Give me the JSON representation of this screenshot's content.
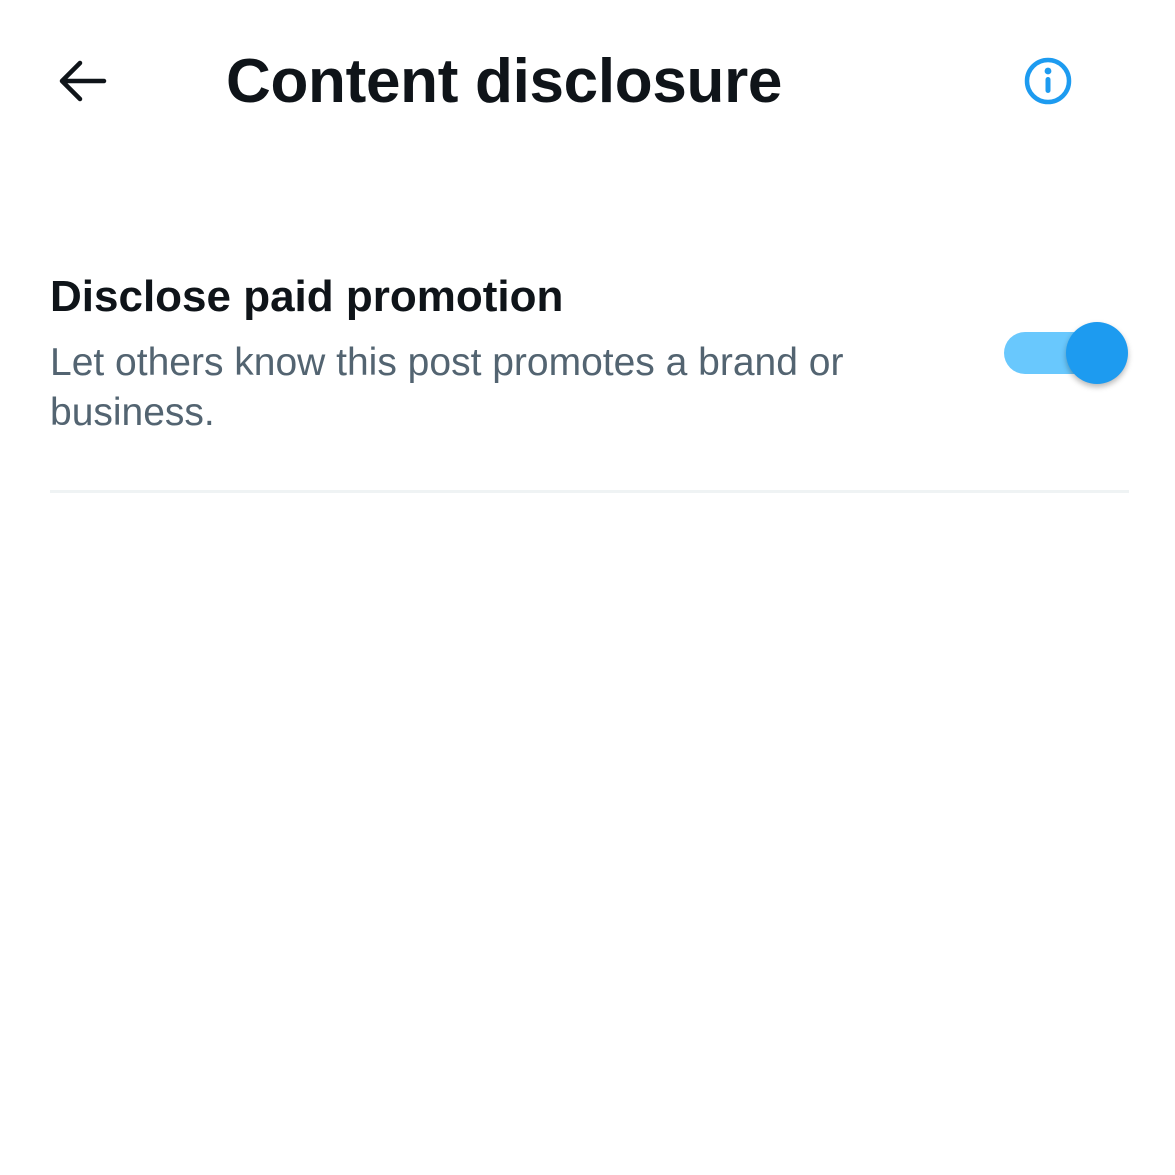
{
  "header": {
    "title": "Content disclosure",
    "back_icon": "arrow-left-icon",
    "info_icon": "info-circle-icon"
  },
  "setting": {
    "title": "Disclose paid promotion",
    "description": "Let others know this post promotes a brand or business.",
    "toggle_on": true
  },
  "colors": {
    "accent": "#1d9bf0",
    "toggle_track": "#69c8fd",
    "text_primary": "#0f1419",
    "text_secondary": "#536471",
    "divider": "#eff3f4"
  }
}
